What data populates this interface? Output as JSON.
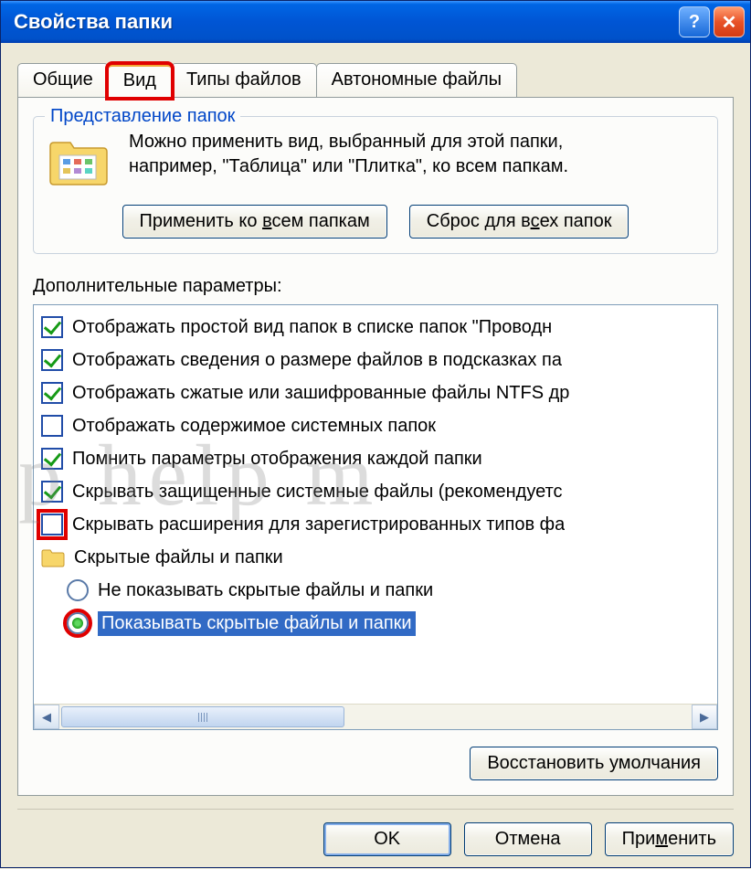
{
  "window": {
    "title": "Свойства папки"
  },
  "tabs": {
    "general": "Общие",
    "view": "Вид",
    "filetypes": "Типы файлов",
    "offline": "Автономные файлы"
  },
  "folderViews": {
    "title": "Представление папок",
    "text1": "Можно применить вид, выбранный для этой папки,",
    "text2": "например, \"Таблица\" или \"Плитка\", ко всем папкам.",
    "applyBtn": "Применить ко всем папкам",
    "resetBtn": "Сброс для всех папок"
  },
  "advanced": {
    "label": "Дополнительные параметры:",
    "items": [
      {
        "type": "checkbox",
        "checked": true,
        "label": "Отображать простой вид папок в списке папок \"Проводн"
      },
      {
        "type": "checkbox",
        "checked": true,
        "label": "Отображать сведения о размере файлов в подсказках па"
      },
      {
        "type": "checkbox",
        "checked": true,
        "label": "Отображать сжатые или зашифрованные файлы NTFS др"
      },
      {
        "type": "checkbox",
        "checked": false,
        "label": "Отображать содержимое системных папок"
      },
      {
        "type": "checkbox",
        "checked": true,
        "label": "Помнить параметры отображения каждой папки"
      },
      {
        "type": "checkbox",
        "checked": true,
        "label": "Скрывать защищенные системные файлы (рекомендуетс"
      },
      {
        "type": "checkbox",
        "checked": false,
        "label": "Скрывать расширения для зарегистрированных типов фа",
        "highlight": true
      },
      {
        "type": "folder",
        "label": "Скрытые файлы и папки"
      },
      {
        "type": "radio",
        "checked": false,
        "label": "Не показывать скрытые файлы и папки"
      },
      {
        "type": "radio",
        "checked": true,
        "label": "Показывать скрытые файлы и папки",
        "highlight": true,
        "selected": true
      }
    ],
    "restoreBtn": "Восстановить умолчания"
  },
  "buttons": {
    "ok": "OK",
    "cancel": "Отмена",
    "apply": "Применить"
  },
  "watermark": "p help   m"
}
